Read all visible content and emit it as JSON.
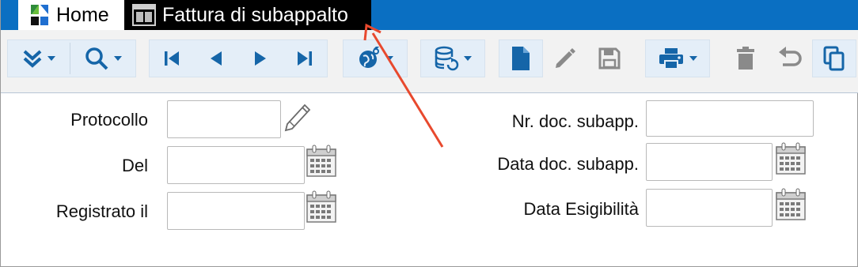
{
  "colors": {
    "tabbar_bg": "#0a6fc2",
    "active_tab_bg": "#000000",
    "toolbar_icon_blue": "#1565a8",
    "toolbar_icon_gray": "#6a6a6a",
    "annotation_arrow": "#e8492e"
  },
  "tabs": [
    {
      "label": "Home",
      "icon": "home-logo-icon",
      "active": false
    },
    {
      "label": "Fattura di subappalto",
      "icon": "form-window-icon",
      "active": true
    }
  ],
  "toolbar": {
    "buttons": [
      "expand-more-icon",
      "search-icon",
      "first-record-icon",
      "previous-record-icon",
      "next-record-icon",
      "last-record-icon",
      "globe-link-icon",
      "database-refresh-icon",
      "new-document-icon",
      "edit-icon",
      "save-icon",
      "print-icon",
      "delete-icon",
      "undo-icon",
      "copy-icon"
    ]
  },
  "form": {
    "protocollo": {
      "label": "Protocollo",
      "value": ""
    },
    "del": {
      "label": "Del",
      "value": ""
    },
    "registrato_il": {
      "label": "Registrato il",
      "value": ""
    },
    "nr_doc_subapp": {
      "label": "Nr. doc. subapp.",
      "value": ""
    },
    "data_doc_subapp": {
      "label": "Data doc. subapp.",
      "value": ""
    },
    "data_esigibilita": {
      "label": "Data Esigibilità",
      "value": ""
    }
  }
}
